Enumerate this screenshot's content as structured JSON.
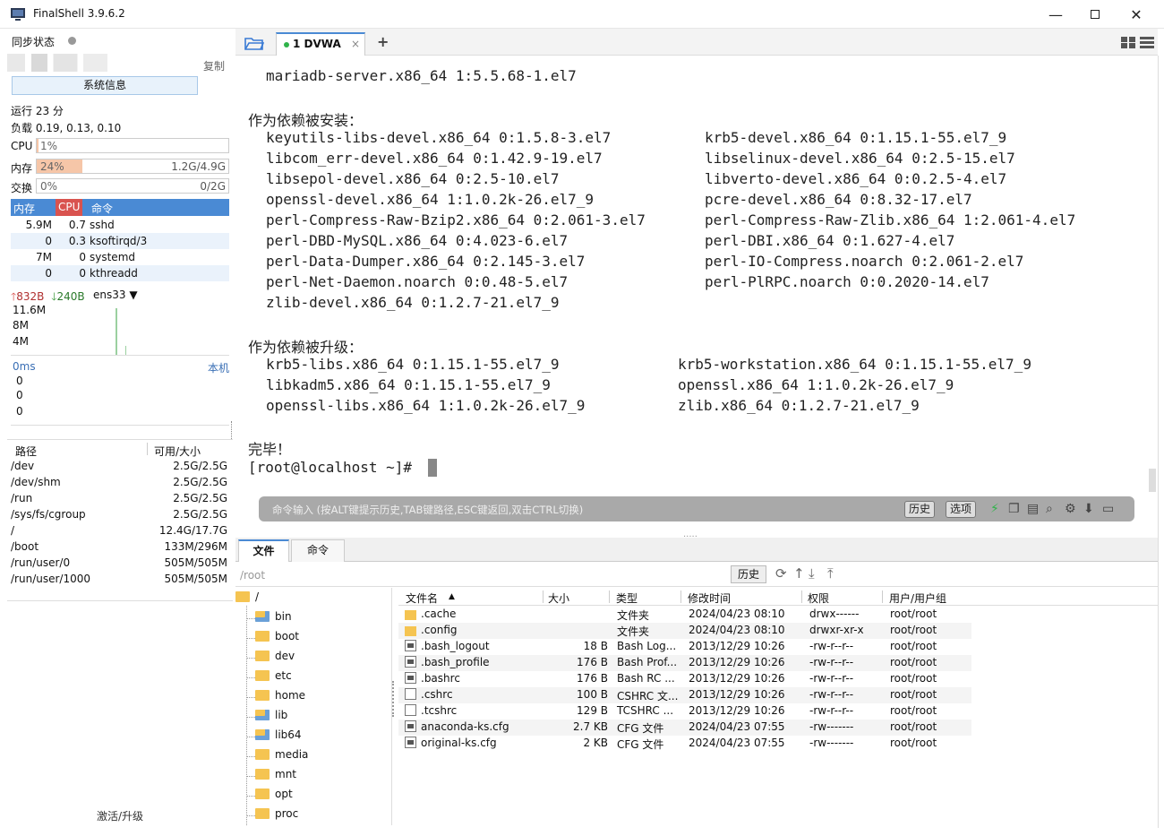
{
  "window": {
    "title": "FinalShell 3.9.6.2",
    "min_icon": "minimize-icon",
    "max_icon": "maximize-icon",
    "close_icon": "close-icon"
  },
  "left": {
    "sync_label": "同步状态",
    "copy_label": "复制",
    "sysinfo_button": "系统信息",
    "uptime": "运行 23 分",
    "load": "负载 0.19, 0.13, 0.10",
    "cpu": {
      "label": "CPU",
      "text": "1%",
      "percent": 1
    },
    "mem": {
      "label": "内存",
      "text": "24%",
      "percent": 24,
      "detail": "1.2G/4.9G"
    },
    "swap": {
      "label": "交换",
      "text": "0%",
      "percent": 0,
      "detail": "0/2G"
    },
    "proc_headers": [
      "内存",
      "CPU",
      "命令"
    ],
    "processes": [
      {
        "mem": "5.9M",
        "cpu": "0.7",
        "cmd": "sshd"
      },
      {
        "mem": "0",
        "cpu": "0.3",
        "cmd": "ksoftirqd/3"
      },
      {
        "mem": "7M",
        "cpu": "0",
        "cmd": "systemd"
      },
      {
        "mem": "0",
        "cpu": "0",
        "cmd": "kthreadd"
      }
    ],
    "net": {
      "up": "832B",
      "down": "240B",
      "iface": "ens33",
      "scale": [
        "11.6M",
        "8M",
        "4M"
      ]
    },
    "ping": {
      "latency": "0ms",
      "host": "本机",
      "values": [
        "0",
        "0",
        "0"
      ]
    },
    "disk_headers": [
      "路径",
      "可用/大小"
    ],
    "disks": [
      {
        "path": "/dev",
        "size": "2.5G/2.5G"
      },
      {
        "path": "/dev/shm",
        "size": "2.5G/2.5G"
      },
      {
        "path": "/run",
        "size": "2.5G/2.5G"
      },
      {
        "path": "/sys/fs/cgroup",
        "size": "2.5G/2.5G"
      },
      {
        "path": "/",
        "size": "12.4G/17.7G"
      },
      {
        "path": "/boot",
        "size": "133M/296M"
      },
      {
        "path": "/run/user/0",
        "size": "505M/505M"
      },
      {
        "path": "/run/user/1000",
        "size": "505M/505M"
      }
    ],
    "activate": "激活/升级"
  },
  "terminal": {
    "tab_label": "1 DVWA",
    "tab_close": "×",
    "add_tab": "+",
    "lines": [
      "mariadb-server.x86_64 1:5.5.68-1.el7"
    ],
    "dep_installed_title": "作为依赖被安装：",
    "dep_installed": [
      [
        "keyutils-libs-devel.x86_64 0:1.5.8-3.el7",
        "krb5-devel.x86_64 0:1.15.1-55.el7_9"
      ],
      [
        "libcom_err-devel.x86_64 0:1.42.9-19.el7",
        "libselinux-devel.x86_64 0:2.5-15.el7"
      ],
      [
        "libsepol-devel.x86_64 0:2.5-10.el7",
        "libverto-devel.x86_64 0:0.2.5-4.el7"
      ],
      [
        "openssl-devel.x86_64 1:1.0.2k-26.el7_9",
        "pcre-devel.x86_64 0:8.32-17.el7"
      ],
      [
        "perl-Compress-Raw-Bzip2.x86_64 0:2.061-3.el7",
        "perl-Compress-Raw-Zlib.x86_64 1:2.061-4.el7"
      ],
      [
        "perl-DBD-MySQL.x86_64 0:4.023-6.el7",
        "perl-DBI.x86_64 0:1.627-4.el7"
      ],
      [
        "perl-Data-Dumper.x86_64 0:2.145-3.el7",
        "perl-IO-Compress.noarch 0:2.061-2.el7"
      ],
      [
        "perl-Net-Daemon.noarch 0:0.48-5.el7",
        "perl-PlRPC.noarch 0:0.2020-14.el7"
      ],
      [
        "zlib-devel.x86_64 0:1.2.7-21.el7_9",
        ""
      ]
    ],
    "dep_upgraded_title": "作为依赖被升级：",
    "dep_upgraded": [
      [
        "krb5-libs.x86_64 0:1.15.1-55.el7_9",
        "krb5-workstation.x86_64 0:1.15.1-55.el7_9"
      ],
      [
        "libkadm5.x86_64 0:1.15.1-55.el7_9",
        "openssl.x86_64 1:1.0.2k-26.el7_9"
      ],
      [
        "openssl-libs.x86_64 1:1.0.2k-26.el7_9",
        "zlib.x86_64 0:1.2.7-21.el7_9"
      ]
    ],
    "done": "完毕！",
    "prompt": "[root@localhost ~]#",
    "cmd_placeholder": "命令输入 (按ALT键提示历史,TAB键路径,ESC键返回,双击CTRL切换)",
    "history_btn": "历史",
    "options_btn": "选项"
  },
  "files": {
    "tabs": [
      "文件",
      "命令"
    ],
    "path": "/root",
    "history_btn": "历史",
    "tree_root": "/",
    "tree": [
      "bin",
      "boot",
      "dev",
      "etc",
      "home",
      "lib",
      "lib64",
      "media",
      "mnt",
      "opt",
      "proc"
    ],
    "tree_links": [
      "bin",
      "lib",
      "lib64"
    ],
    "headers": [
      "文件名",
      "大小",
      "类型",
      "修改时间",
      "权限",
      "用户/用户组"
    ],
    "rows": [
      {
        "name": ".cache",
        "size": "",
        "type": "文件夹",
        "mtime": "2024/04/23 08:10",
        "perm": "drwx------",
        "owner": "root/root",
        "icon": "folder"
      },
      {
        "name": ".config",
        "size": "",
        "type": "文件夹",
        "mtime": "2024/04/23 08:10",
        "perm": "drwxr-xr-x",
        "owner": "root/root",
        "icon": "folder"
      },
      {
        "name": ".bash_logout",
        "size": "18 B",
        "type": "Bash Log...",
        "mtime": "2013/12/29 10:26",
        "perm": "-rw-r--r--",
        "owner": "root/root",
        "icon": "script"
      },
      {
        "name": ".bash_profile",
        "size": "176 B",
        "type": "Bash Prof...",
        "mtime": "2013/12/29 10:26",
        "perm": "-rw-r--r--",
        "owner": "root/root",
        "icon": "script"
      },
      {
        "name": ".bashrc",
        "size": "176 B",
        "type": "Bash RC ...",
        "mtime": "2013/12/29 10:26",
        "perm": "-rw-r--r--",
        "owner": "root/root",
        "icon": "script"
      },
      {
        "name": ".cshrc",
        "size": "100 B",
        "type": "CSHRC 文...",
        "mtime": "2013/12/29 10:26",
        "perm": "-rw-r--r--",
        "owner": "root/root",
        "icon": "file"
      },
      {
        "name": ".tcshrc",
        "size": "129 B",
        "type": "TCSHRC ...",
        "mtime": "2013/12/29 10:26",
        "perm": "-rw-r--r--",
        "owner": "root/root",
        "icon": "file"
      },
      {
        "name": "anaconda-ks.cfg",
        "size": "2.7 KB",
        "type": "CFG 文件",
        "mtime": "2024/04/23 07:55",
        "perm": "-rw-------",
        "owner": "root/root",
        "icon": "script"
      },
      {
        "name": "original-ks.cfg",
        "size": "2 KB",
        "type": "CFG 文件",
        "mtime": "2024/04/23 07:55",
        "perm": "-rw-------",
        "owner": "root/root",
        "icon": "script"
      }
    ]
  },
  "colors": {
    "accent": "#4a8ad4",
    "mem_fill": "#f6c6a8",
    "up_arrow": "#d9534f",
    "down_arrow": "#3a9a3a",
    "folder": "#f5c451"
  }
}
